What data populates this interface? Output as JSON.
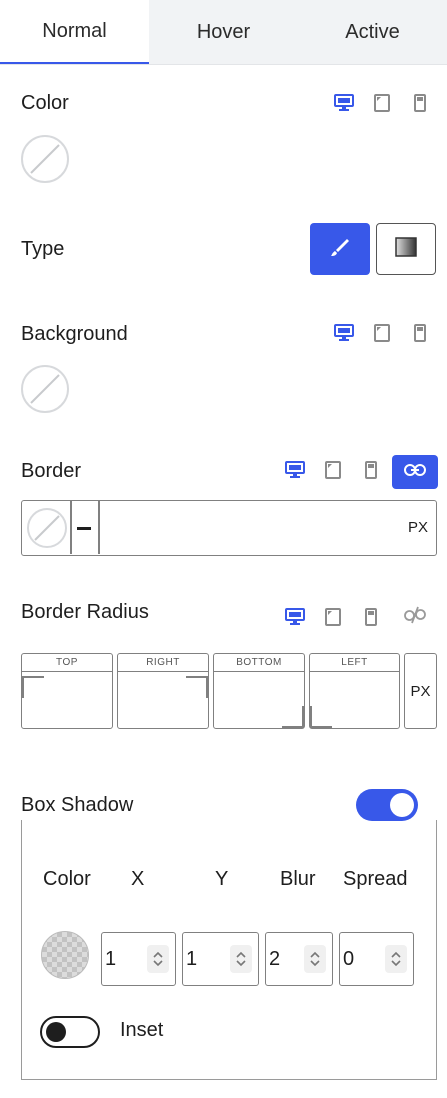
{
  "tabs": [
    {
      "label": "Normal",
      "active": true
    },
    {
      "label": "Hover",
      "active": false
    },
    {
      "label": "Active",
      "active": false
    }
  ],
  "color": {
    "label": "Color",
    "value": "none"
  },
  "type": {
    "label": "Type",
    "options": [
      "solid",
      "gradient"
    ],
    "selected": "solid"
  },
  "background": {
    "label": "Background",
    "value": "none"
  },
  "border": {
    "label": "Border",
    "width": "",
    "unit": "PX",
    "linked": true
  },
  "border_radius": {
    "label": "Border Radius",
    "sides": [
      "TOP",
      "RIGHT",
      "BOTTOM",
      "LEFT"
    ],
    "unit": "PX",
    "linked": false
  },
  "box_shadow": {
    "label": "Box Shadow",
    "enabled": true,
    "headers": {
      "color": "Color",
      "x": "X",
      "y": "Y",
      "blur": "Blur",
      "spread": "Spread"
    },
    "values": {
      "x": "1",
      "y": "1",
      "blur": "2",
      "spread": "0"
    },
    "inset_label": "Inset",
    "inset": false
  },
  "icons": {
    "desktop": "desktop-icon",
    "tablet": "tablet-icon",
    "mobile": "mobile-icon",
    "link": "link-icon",
    "unlink": "unlink-icon"
  },
  "colors": {
    "accent": "#3858e9",
    "inactive_icon": "#8a8a8a",
    "border": "#808080"
  }
}
